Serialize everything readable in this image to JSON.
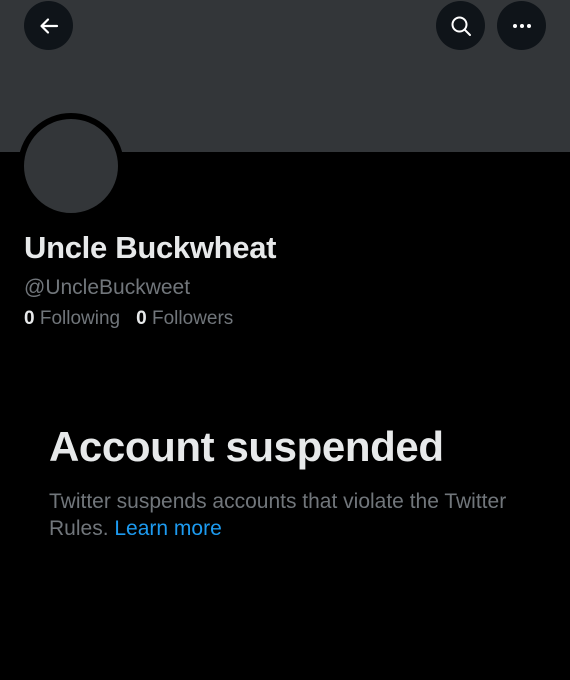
{
  "profile": {
    "display_name": "Uncle Buckwheat",
    "handle": "@UncleBuckweet",
    "following_count": "0",
    "following_label": "Following",
    "followers_count": "0",
    "followers_label": "Followers"
  },
  "header": {
    "back_icon": "arrow-left-icon",
    "search_icon": "search-icon",
    "more_icon": "more-horizontal-icon"
  },
  "suspension": {
    "title": "Account suspended",
    "message": "Twitter suspends accounts that violate the Twitter Rules.",
    "link_label": "Learn more"
  },
  "colors": {
    "background": "#000000",
    "banner": "#333639",
    "primary_text": "#e7e9ea",
    "secondary_text": "#71767b",
    "link": "#1d9bf0"
  }
}
